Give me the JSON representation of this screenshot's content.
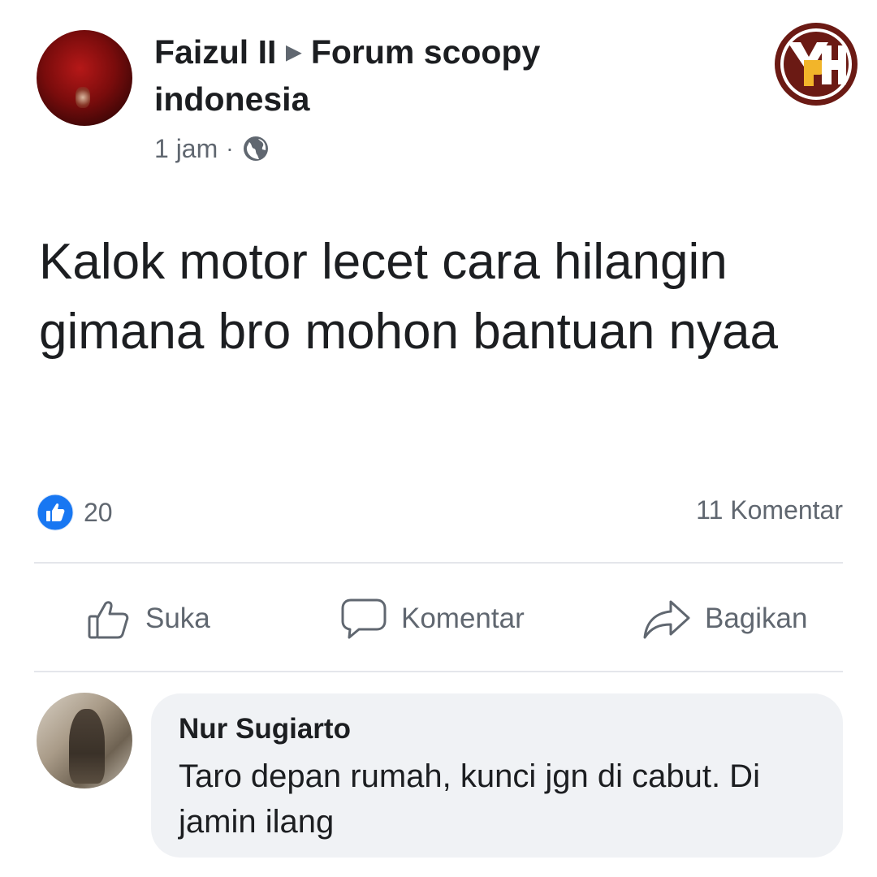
{
  "post": {
    "author": "Faizul II",
    "group_line1": "Forum scoopy",
    "group_line2": "indonesia",
    "time": "1 jam",
    "separator": "·",
    "privacy_icon": "globe-icon",
    "text": "Kalok motor lecet cara hilangin gimana bro mohon bantuan nyaa"
  },
  "stats": {
    "likes": "20",
    "comments": "11 Komentar"
  },
  "actions": {
    "like": "Suka",
    "comment": "Komentar",
    "share": "Bagikan"
  },
  "comment": {
    "author": "Nur Sugiarto",
    "text": "Taro depan rumah, kunci jgn di cabut. Di jamin ilang"
  },
  "watermark": {
    "text": "YPH"
  },
  "colors": {
    "text": "#1c1e21",
    "secondary": "#606770",
    "like_blue": "#1877f2",
    "bubble": "#f0f2f5",
    "logo_brown": "#6b1a14",
    "logo_gold": "#f2b52a"
  }
}
